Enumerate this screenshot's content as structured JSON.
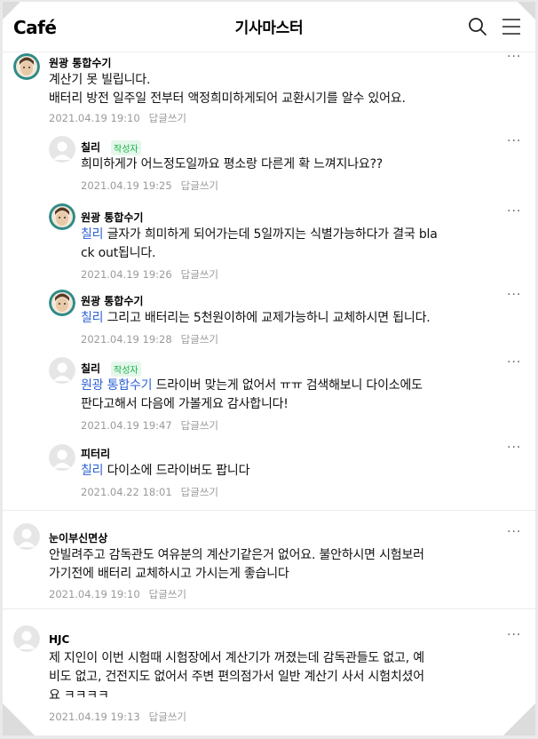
{
  "header": {
    "logo": "Café",
    "title": "기사마스터",
    "search_icon": "search-icon",
    "menu_icon": "hamburger-menu-icon"
  },
  "colors": {
    "mention": "#2e62d6",
    "badge_text": "#19b34a",
    "badge_bg": "#e4f7ea",
    "meta": "#9a9a9a"
  },
  "comments": [
    {
      "author": "원광 통합수기",
      "avatar": "avatar-person",
      "badge": "",
      "mention": "",
      "lines": [
        "계산기 못 빌립니다.",
        "배터리 방전 일주일 전부터 액정희미하게되어 교환시기를 알수 있어요."
      ],
      "date": "2021.04.19 19:10",
      "reply": "답글쓰기"
    },
    {
      "author": "칠리",
      "avatar": "avatar-default",
      "badge": "작성자",
      "mention": "",
      "lines": [
        "희미하게가 어느정도일까요 평소랑 다른게 확 느껴지나요??"
      ],
      "date": "2021.04.19 19:25",
      "reply": "답글쓰기"
    },
    {
      "author": "원광 통합수기",
      "avatar": "avatar-person",
      "badge": "",
      "mention": "칠리",
      "lines": [
        " 글자가 희미하게 되어가는데 5일까지는 식별가능하다가 결국 bla",
        "ck out됩니다."
      ],
      "date": "2021.04.19 19:26",
      "reply": "답글쓰기"
    },
    {
      "author": "원광 통합수기",
      "avatar": "avatar-person",
      "badge": "",
      "mention": "칠리",
      "lines": [
        " 그리고 배터리는 5천원이하에 교제가능하니 교체하시면 됩니다."
      ],
      "date": "2021.04.19 19:28",
      "reply": "답글쓰기"
    },
    {
      "author": "칠리",
      "avatar": "avatar-default",
      "badge": "작성자",
      "mention": "원광 통합수기",
      "lines": [
        " 드라이버 맞는게 없어서 ㅠㅠ 검색해보니 다이소에도",
        "판다고해서 다음에 가볼게요 감사합니다!"
      ],
      "date": "2021.04.19 19:47",
      "reply": "답글쓰기"
    },
    {
      "author": "피터리",
      "avatar": "avatar-default",
      "badge": "",
      "mention": "칠리",
      "lines": [
        " 다이소에 드라이버도 팝니다"
      ],
      "date": "2021.04.22 18:01",
      "reply": "답글쓰기"
    },
    {
      "author": "눈이부신면상",
      "avatar": "avatar-default",
      "badge": "",
      "mention": "",
      "lines": [
        "안빌려주고 감독관도 여유분의 계산기같은거 없어요. 불안하시면 시험보러",
        "가기전에 배터리 교체하시고 가시는게 좋습니다"
      ],
      "date": "2021.04.19 19:10",
      "reply": "답글쓰기"
    },
    {
      "author": "HJC",
      "avatar": "avatar-default",
      "badge": "",
      "mention": "",
      "lines": [
        "제 지인이 이번 시험때 시험장에서 계산기가 꺼졌는데 감독관들도 없고, 예",
        "비도 없고, 건전지도 없어서 주변 편의점가서 일반 계산기 사서 시험치셨어",
        "요 ㅋㅋㅋㅋ"
      ],
      "date": "2021.04.19 19:13",
      "reply": "답글쓰기"
    }
  ]
}
